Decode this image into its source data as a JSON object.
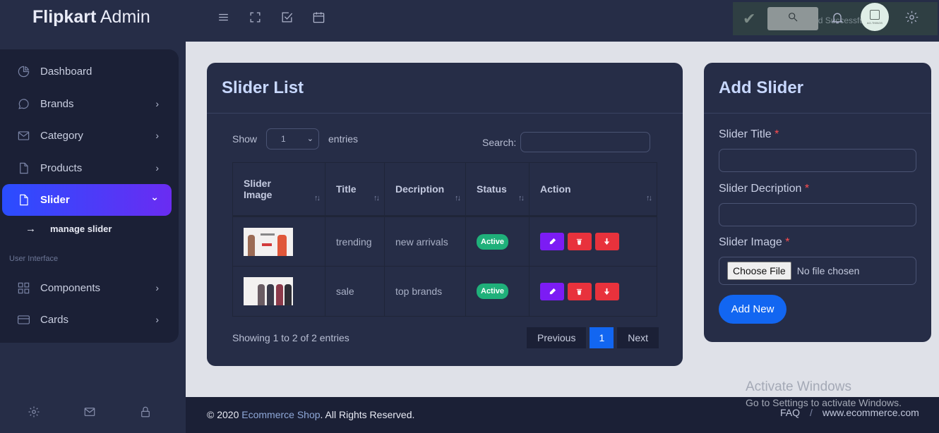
{
  "app": {
    "brand_bold": "Flipkart",
    "brand_rest": " Admin"
  },
  "sidebar": {
    "items": [
      {
        "label": "Dashboard",
        "icon": "pie-chart-icon",
        "chevron": ""
      },
      {
        "label": "Brands",
        "icon": "chat-bubble-icon",
        "chevron": "›"
      },
      {
        "label": "Category",
        "icon": "mail-icon",
        "chevron": "›"
      },
      {
        "label": "Products",
        "icon": "file-icon",
        "chevron": "›"
      },
      {
        "label": "Slider",
        "icon": "file-icon",
        "chevron": "⌄",
        "active": true
      }
    ],
    "sub_item": {
      "arrow": "→",
      "label": "manage slider"
    },
    "section_label": "User Interface",
    "ui_items": [
      {
        "label": "Components",
        "icon": "grid-icon",
        "chevron": "›"
      },
      {
        "label": "Cards",
        "icon": "credit-card-icon",
        "chevron": "›"
      }
    ],
    "bottom_icons": [
      "gear-icon",
      "mail-icon",
      "lock-icon"
    ]
  },
  "topbar": {
    "icons": [
      "menu-icon",
      "fullscreen-icon",
      "checkbox-icon",
      "calendar-icon"
    ],
    "toast": {
      "check": "✔",
      "message": "Slider Inserted Successfully"
    },
    "avatar_text": "AG-THINGS"
  },
  "slider_list": {
    "title": "Slider List",
    "show_label": "Show",
    "show_value": "1",
    "entries_label": "entries",
    "search_label": "Search:",
    "columns": [
      {
        "label": "Slider Image",
        "sort": "↑↓"
      },
      {
        "label": "Title",
        "sort": "↑↓"
      },
      {
        "label": "Decription",
        "sort": "↑↓"
      },
      {
        "label": "Status",
        "sort": "↑↓"
      },
      {
        "label": "Action",
        "sort": "↑↓"
      }
    ],
    "rows": [
      {
        "title": "trending",
        "description": "new arrivals",
        "status": "Active"
      },
      {
        "title": "sale",
        "description": "top brands",
        "status": "Active"
      }
    ],
    "showing_text": "Showing 1 to 2 of 2 entries",
    "pagination": {
      "previous": "Previous",
      "current": "1",
      "next": "Next"
    }
  },
  "add_slider": {
    "title": "Add Slider",
    "title_label": "Slider Title",
    "description_label": "Slider Decription",
    "image_label": "Slider Image",
    "required_mark": "*",
    "choose_file": "Choose File",
    "no_file": "No file chosen",
    "submit": "Add New"
  },
  "footer": {
    "copy_prefix": "© 2020 ",
    "copy_link": "Ecommerce Shop",
    "copy_suffix": ". All Rights Reserved.",
    "faq": "FAQ",
    "separator": "/",
    "site": "www.ecommerce.com"
  },
  "watermark": {
    "line1": "Activate Windows",
    "line2": "Go to Settings to activate Windows."
  },
  "colors": {
    "accent_blue": "#1266f1",
    "active_gradient_start": "#2a4dff",
    "active_gradient_end": "#6a2cf2",
    "status_green": "#1fb07a",
    "edit_purple": "#7c1cf4",
    "danger_red": "#e8323c"
  }
}
